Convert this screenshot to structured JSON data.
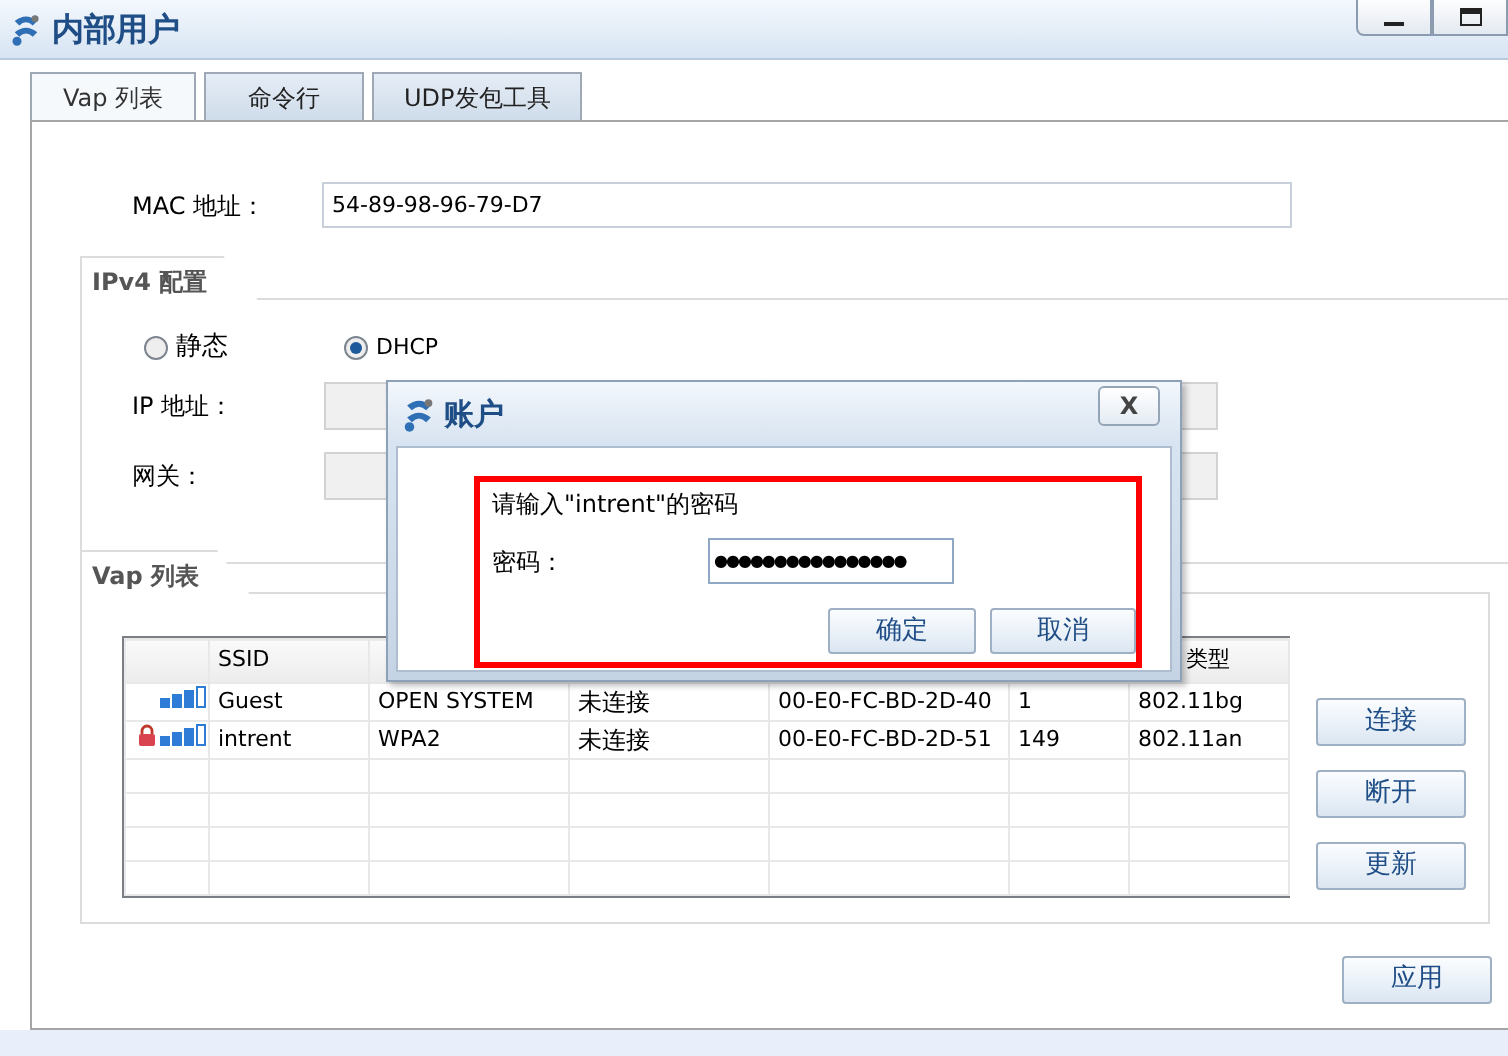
{
  "window": {
    "title": "内部用户"
  },
  "tabs": [
    {
      "label": "Vap 列表",
      "selected": true
    },
    {
      "label": "命令行",
      "selected": false
    },
    {
      "label": "UDP发包工具",
      "selected": false
    }
  ],
  "mac": {
    "label": "MAC 地址：",
    "value": "54-89-98-96-79-D7"
  },
  "ipv4": {
    "title": "IPv4 配置",
    "modes": [
      {
        "label": "静态",
        "selected": false
      },
      {
        "label": "DHCP",
        "selected": true
      }
    ],
    "fields": [
      {
        "label": "IP 地址："
      },
      {
        "label": "网关："
      }
    ]
  },
  "vap": {
    "title": "Vap 列表",
    "headers": {
      "column_2": "SSID",
      "column_7": "类型"
    },
    "rows": [
      {
        "locked": false,
        "cells": [
          "Guest",
          "OPEN SYSTEM",
          "未连接",
          "00-E0-FC-BD-2D-40",
          "1",
          "802.11bg"
        ]
      },
      {
        "locked": true,
        "cells": [
          "intrent",
          "WPA2",
          "未连接",
          "00-E0-FC-BD-2D-51",
          "149",
          "802.11an"
        ]
      }
    ],
    "buttons": [
      "连接",
      "断开",
      "更新"
    ]
  },
  "apply_button": "应用",
  "dialog": {
    "title": "账户",
    "close": "X",
    "prompt": "请输入\"intrent\"的密码",
    "password_label": "密码：",
    "password_value": "●●●●●●●●●●●●●●●●",
    "buttons": [
      "确定",
      "取消"
    ]
  }
}
